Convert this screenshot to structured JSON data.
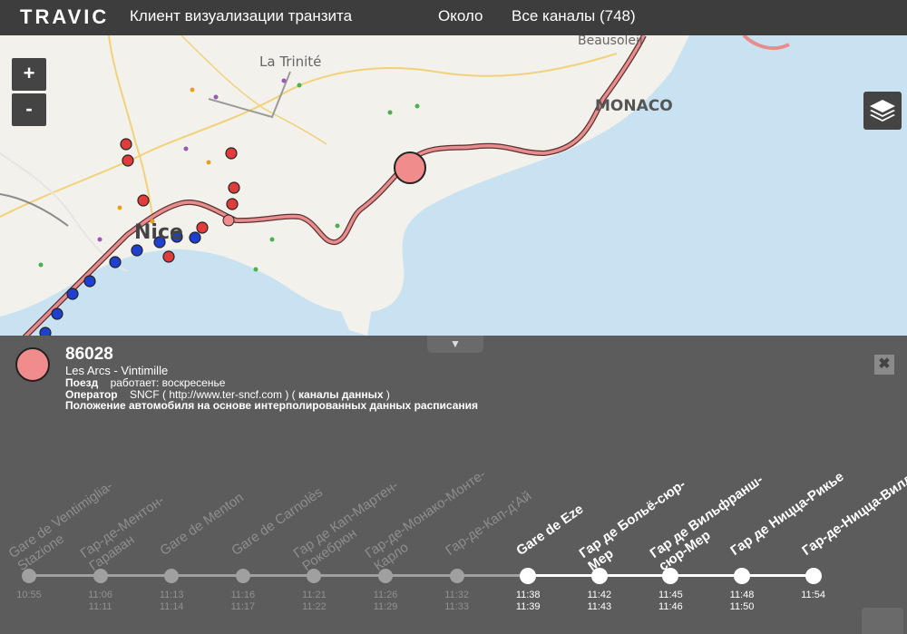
{
  "app": {
    "logo": "TRAVIC",
    "subtitle": "Клиент визуализации транзита",
    "nav_about": "Около",
    "nav_channels": "Все каналы (748)"
  },
  "map": {
    "zoom_in": "+",
    "zoom_out": "-",
    "labels": {
      "la_trinite": "La Trinité",
      "monaco": "MONACO",
      "beausoleil": "Beausoleil",
      "nice": "Nice"
    },
    "colors": {
      "sea": "#c9e2f2",
      "land": "#f3f1ec",
      "route": "#e88d8d",
      "blue_vehicle": "#1f3fcf",
      "red_vehicle": "#e23b3b"
    }
  },
  "panel": {
    "collapse_icon": "▼",
    "close_icon": "✖",
    "train_number": "86028",
    "route": "Les Arcs - Vintimille",
    "train_label": "Поезд",
    "train_value": "работает: воскресенье",
    "operator_label": "Оператор",
    "operator_value": "SNCF ( http://www.ter-sncf.com ) (",
    "operator_link": "каналы данных",
    "operator_end": ")",
    "position_note": "Положение автомобиля на основе интерполированных данных расписания"
  },
  "stops": [
    {
      "name": "Gare de Ventimiglia-Stazione",
      "dep": "",
      "arr": "10:55",
      "state": "past"
    },
    {
      "name": "Гар-де-Ментон-Гараван",
      "dep": "11:06",
      "arr": "11:11",
      "state": "past"
    },
    {
      "name": "Gare de Menton",
      "dep": "11:13",
      "arr": "11:14",
      "state": "past"
    },
    {
      "name": "Gare de Carnolès",
      "dep": "11:16",
      "arr": "11:17",
      "state": "past"
    },
    {
      "name": "Гар де Кап-Мартен-Рокебрюн",
      "dep": "11:21",
      "arr": "11:22",
      "state": "past"
    },
    {
      "name": "Гар-де-Монако-Монте-Карло",
      "dep": "11:26",
      "arr": "11:29",
      "state": "past"
    },
    {
      "name": "Гар-де-Кап-д'Ай",
      "dep": "11:32",
      "arr": "11:33",
      "state": "past"
    },
    {
      "name": "Gare de Eze",
      "dep": "11:38",
      "arr": "11:39",
      "state": "future"
    },
    {
      "name": "Гар де Больё-сюр-Мер",
      "dep": "11:42",
      "arr": "11:43",
      "state": "future"
    },
    {
      "name": "Гар де Вильфранш-сюр-Мер",
      "dep": "11:45",
      "arr": "11:46",
      "state": "future"
    },
    {
      "name": "Гар де Ницца-Рикье",
      "dep": "11:48",
      "arr": "11:50",
      "state": "future"
    },
    {
      "name": "Гар-де-Ницца-Вилль",
      "dep": "",
      "arr": "11:54",
      "state": "future"
    }
  ]
}
